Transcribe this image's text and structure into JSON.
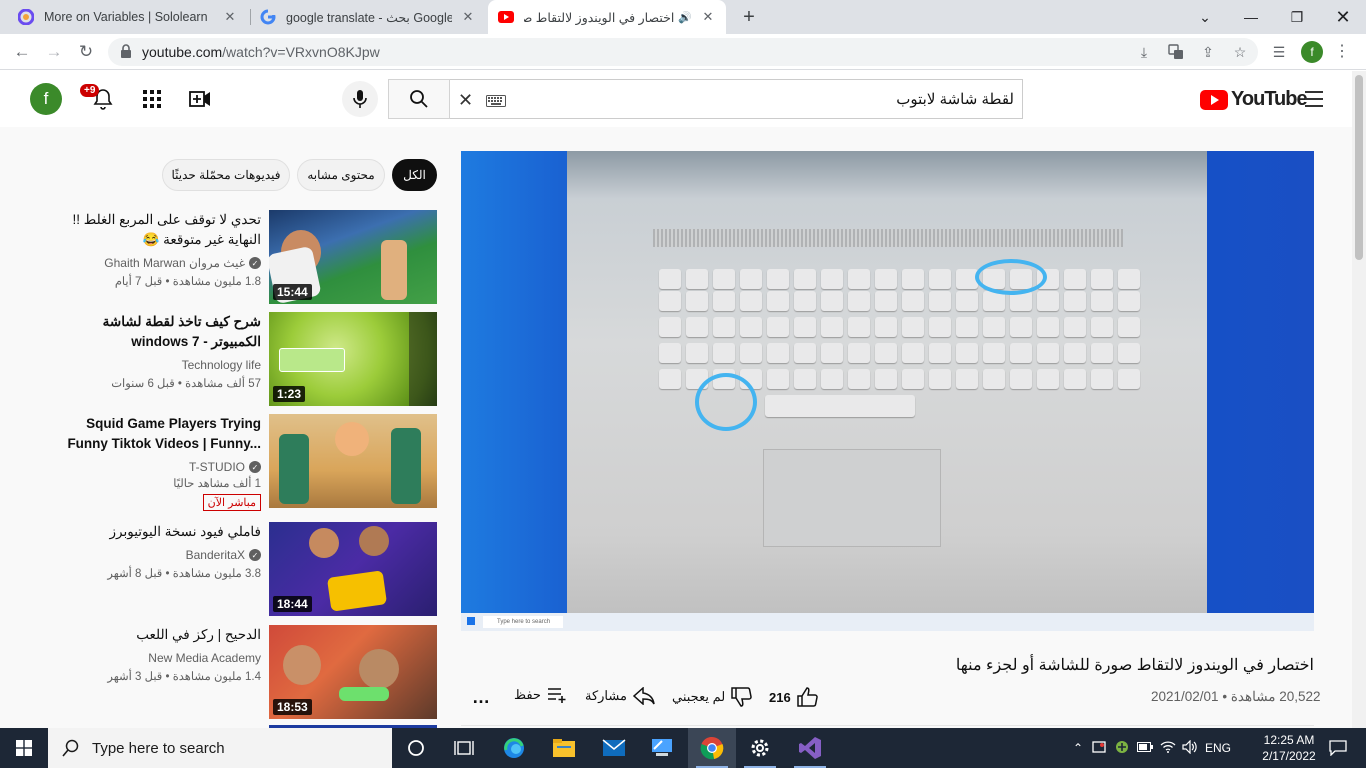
{
  "browser": {
    "tabs": [
      {
        "title": "More on Variables | Sololearn",
        "active": false
      },
      {
        "title": "google translate - بحث Google",
        "active": false
      },
      {
        "title": "اختصار في الويندوز لالتقاط صو",
        "active": true
      }
    ],
    "url_host": "youtube.com",
    "url_path": "/watch?v=VRxvnO8KJpw",
    "profile_initial": "f"
  },
  "youtube": {
    "avatar_initial": "f",
    "notification_count": "+9",
    "search_query": "لقطة شاشة لابتوب",
    "logo_text": "YouTube",
    "chips": [
      "الكل",
      "محتوى مشابه",
      "فيديوهات محمّلة حديثًا"
    ],
    "video": {
      "title": "اختصار في الويندوز لالتقاط صورة للشاشة أو لجزء منها",
      "views": "20,522 مشاهدة",
      "date": "2021/02/01",
      "likes": "216",
      "dislike_label": "لم يعجبني",
      "share_label": "مشاركة",
      "save_label": "حفظ",
      "overlay_search_text": "Type here to search"
    },
    "recommendations": [
      {
        "title": "تحدي لا توقف على المربع الغلط !! النهاية غير متوقعة 😂",
        "channel": "Ghaith Marwan غيث مروان",
        "verified": true,
        "meta": "1.8 مليون مشاهدة • قبل 7 أيام",
        "duration": "15:44"
      },
      {
        "title": "شرح كيف تاخذ لقطة لشاشة الكمبيوتر - windows 7",
        "channel": "Technology life",
        "verified": false,
        "meta": "57 ألف مشاهدة • قبل 6 سنوات",
        "duration": "1:23"
      },
      {
        "title": "Squid Game Players Trying Funny Tiktok Videos | Funny...",
        "channel": "T-STUDIO",
        "verified": true,
        "meta": "1 ألف مشاهد حاليًا",
        "live": "مباشر الآن",
        "duration": ""
      },
      {
        "title": "فاملي فيود نسخة اليوتيوبرز",
        "channel": "BanderitaX",
        "verified": true,
        "meta": "3.8 مليون مشاهدة • قبل 8 أشهر",
        "duration": "18:44"
      },
      {
        "title": "الدحيح | ركز في اللعب",
        "channel": "New Media Academy",
        "verified": false,
        "meta": "1.4 مليون مشاهدة • قبل 3 أشهر",
        "duration": "18:53"
      }
    ]
  },
  "taskbar": {
    "search_placeholder": "Type here to search",
    "language": "ENG",
    "time": "12:25 AM",
    "date": "2/17/2022"
  },
  "colors": {
    "youtube_red": "#ff0000",
    "taskbar_bg": "#1d2736",
    "chrome_tabstrip": "#dee1e6",
    "avatar_green": "#3b8a2a",
    "video_bg_blue": "#1650c6"
  }
}
